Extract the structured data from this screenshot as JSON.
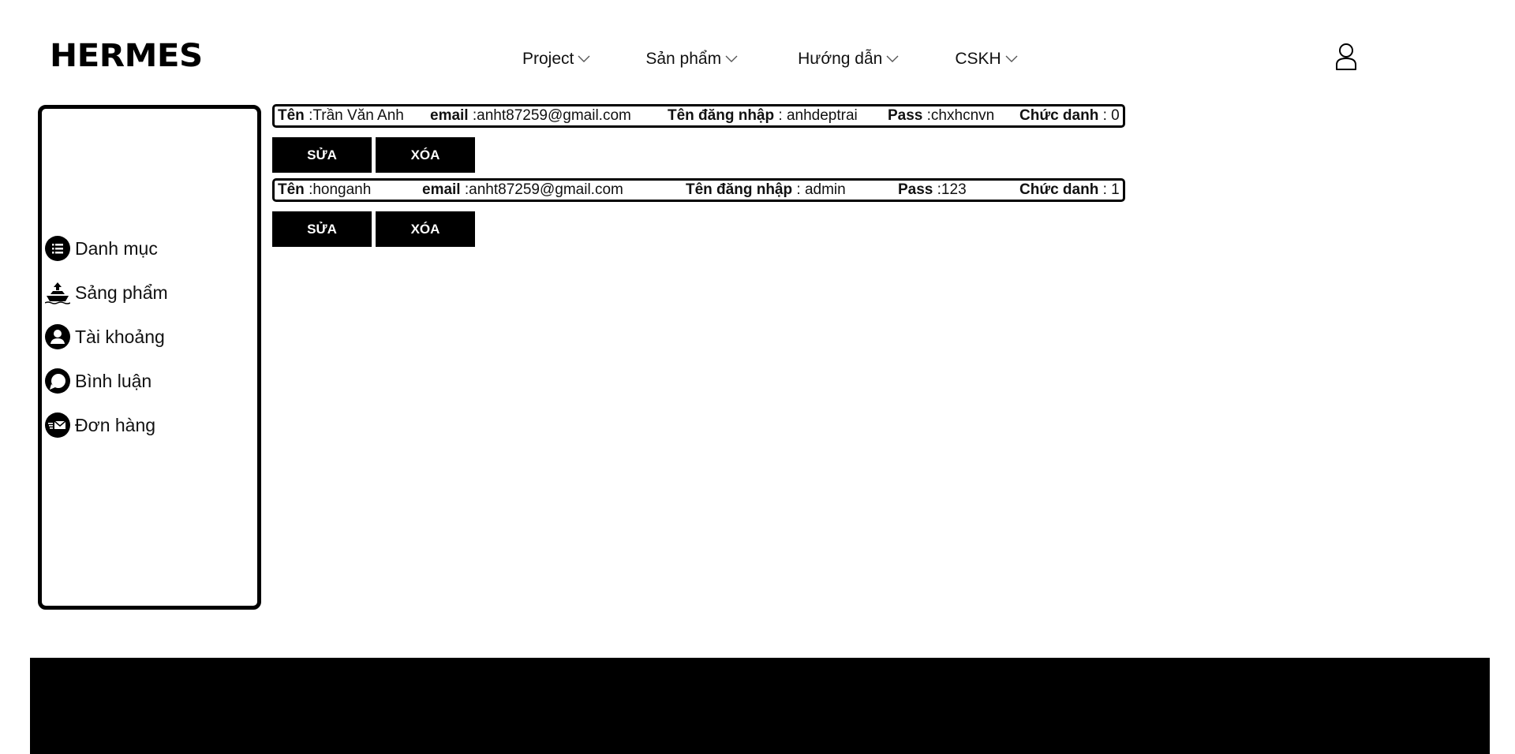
{
  "header": {
    "logo": "HERMES",
    "nav": [
      {
        "label": "Project"
      },
      {
        "label": "Sản phẩm"
      },
      {
        "label": "Hướng dẫn"
      },
      {
        "label": "CSKH"
      }
    ],
    "user_icon": "user-icon"
  },
  "sidebar": {
    "items": [
      {
        "label": "Danh mục",
        "icon": "list-icon"
      },
      {
        "label": "Sảng phẩm",
        "icon": "ship-icon"
      },
      {
        "label": "Tài khoảng",
        "icon": "person-icon"
      },
      {
        "label": "Bình luận",
        "icon": "chat-icon"
      },
      {
        "label": "Đơn hàng",
        "icon": "mail-icon"
      }
    ]
  },
  "labels": {
    "name": "Tên",
    "email": "email",
    "username": "Tên đăng nhập",
    "pass": "Pass",
    "role": "Chức danh",
    "edit": "SỬA",
    "delete": "XÓA"
  },
  "accounts": [
    {
      "name": ":Trần Văn Anh",
      "email": ":anht87259@gmail.com",
      "username": ": anhdeptrai",
      "pass": ":chxhcnvn",
      "role": ": 0"
    },
    {
      "name": ":honganh",
      "email": ":anht87259@gmail.com",
      "username": ": admin",
      "pass": ":123",
      "role": ": 1"
    }
  ],
  "colors": {
    "background": "#ffffff",
    "primary": "#000000",
    "button_text": "#ffffff"
  }
}
